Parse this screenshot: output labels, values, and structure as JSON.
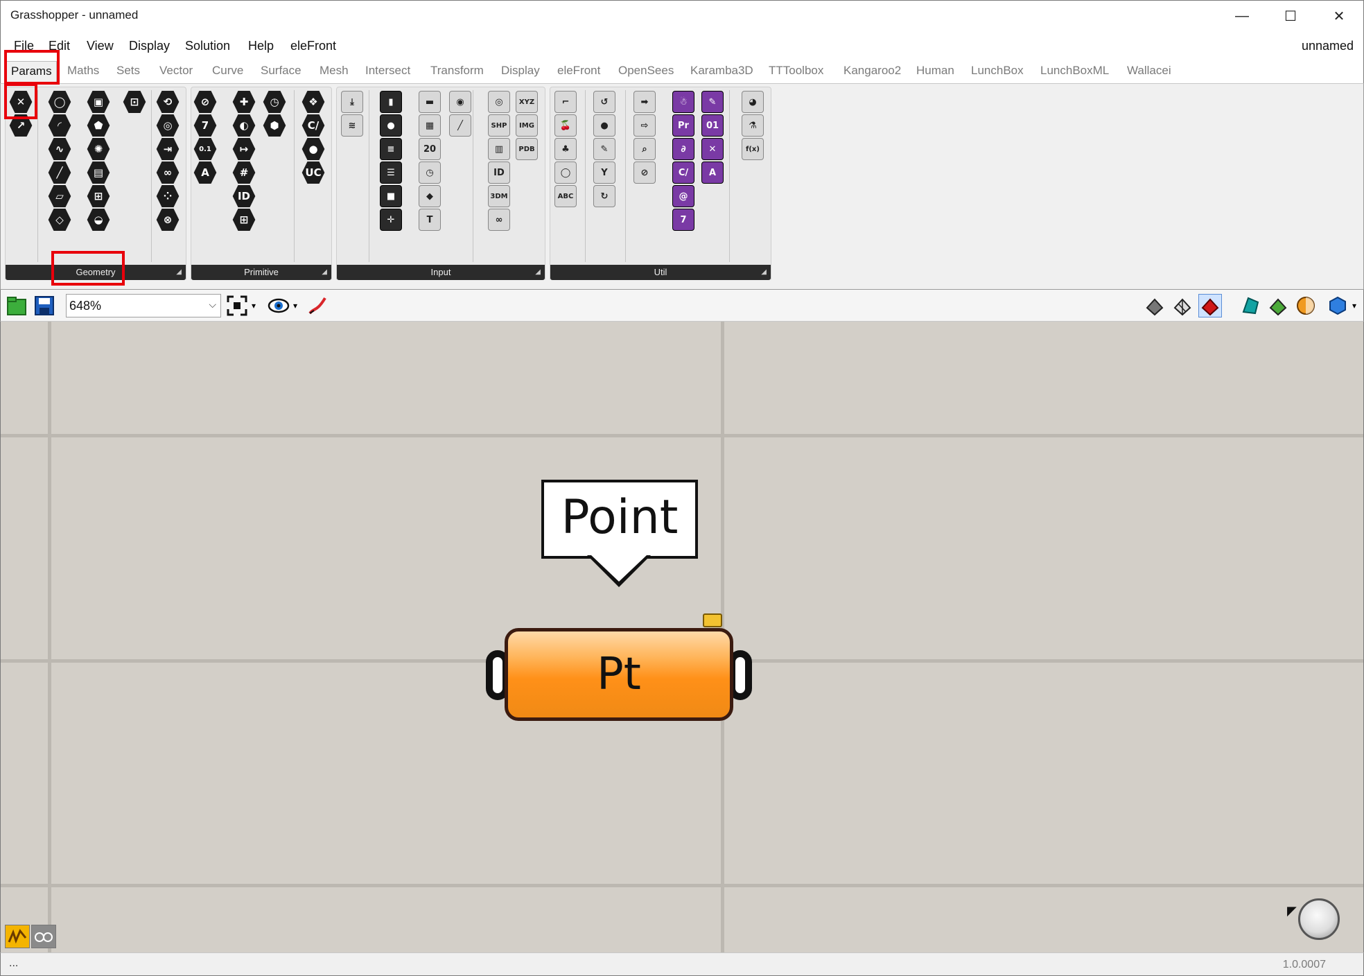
{
  "window": {
    "title": "Grasshopper - unnamed",
    "minimize": "—",
    "maximize": "☐",
    "close": "✕"
  },
  "menu": {
    "items": [
      "File",
      "Edit",
      "View",
      "Display",
      "Solution",
      "Help",
      "eleFront"
    ],
    "document_name": "unnamed"
  },
  "tabs": [
    "Params",
    "Maths",
    "Sets",
    "Vector",
    "Curve",
    "Surface",
    "Mesh",
    "Intersect",
    "Transform",
    "Display",
    "eleFront",
    "OpenSees",
    "Karamba3D",
    "TTToolbox",
    "Kangaroo2",
    "Human",
    "LunchBox",
    "LunchBoxML",
    "Wallacei"
  ],
  "active_tab": "Params",
  "panels": {
    "geometry": "Geometry",
    "primitive": "Primitive",
    "input": "Input",
    "util": "Util"
  },
  "ribbon_icons": {
    "geometry": [
      {
        "name": "point-param-icon",
        "glyph": "✕"
      },
      {
        "name": "vector-param-icon",
        "glyph": "↗"
      },
      {
        "name": "circle-param-icon",
        "glyph": "◯"
      },
      {
        "name": "arc-param-icon",
        "glyph": "◜"
      },
      {
        "name": "curve-param-icon",
        "glyph": "∿"
      },
      {
        "name": "line-param-icon",
        "glyph": "╱"
      },
      {
        "name": "rectangle-param-icon",
        "glyph": "▱"
      },
      {
        "name": "plane-param-icon",
        "glyph": "◇"
      },
      {
        "name": "box-param-icon",
        "glyph": "▣"
      },
      {
        "name": "brep-param-icon",
        "glyph": "⬟"
      },
      {
        "name": "mesh-param-icon",
        "glyph": "✺"
      },
      {
        "name": "surface-param-icon",
        "glyph": "▤"
      },
      {
        "name": "field-param-icon",
        "glyph": "⊞"
      },
      {
        "name": "atom-param-icon",
        "glyph": "◒"
      },
      {
        "name": "group-param-icon",
        "glyph": "⊡"
      },
      {
        "name": "twisted-box-param-icon",
        "glyph": "⟲"
      },
      {
        "name": "spiral-param-icon",
        "glyph": "◎"
      },
      {
        "name": "transform-param-icon",
        "glyph": "⇥"
      },
      {
        "name": "loop-param-icon",
        "glyph": "∞"
      },
      {
        "name": "cluster-param-icon",
        "glyph": "⁘"
      },
      {
        "name": "geometry-param-icon",
        "glyph": "⊗"
      }
    ],
    "primitive": [
      {
        "name": "boolean-param-icon",
        "glyph": "⊘"
      },
      {
        "name": "integer-param-icon",
        "glyph": "7"
      },
      {
        "name": "number-param-icon",
        "glyph": "0.1"
      },
      {
        "name": "text-param-icon",
        "glyph": "A"
      },
      {
        "name": "domain-param-icon",
        "glyph": "✚"
      },
      {
        "name": "shader-param-icon",
        "glyph": "◐"
      },
      {
        "name": "interval-param-icon",
        "glyph": "↦"
      },
      {
        "name": "domain2-param-icon",
        "glyph": "#"
      },
      {
        "name": "guid-param-icon",
        "glyph": "ID"
      },
      {
        "name": "matrix-param-icon",
        "glyph": "⊞"
      },
      {
        "name": "time-param-icon",
        "glyph": "◷"
      },
      {
        "name": "complex-param-icon",
        "glyph": "⬢"
      },
      {
        "name": "structure-param-icon",
        "glyph": "❖"
      },
      {
        "name": "culture-param-icon",
        "glyph": "C/"
      },
      {
        "name": "material-param-icon",
        "glyph": "●"
      },
      {
        "name": "file-path-param-icon",
        "glyph": "UC"
      }
    ],
    "input": [
      {
        "name": "data-input-icon",
        "glyph": "⤓"
      },
      {
        "name": "graph-mapper-icon",
        "glyph": "≋"
      },
      {
        "name": "toggle-icon",
        "glyph": "▮"
      },
      {
        "name": "button-icon",
        "glyph": "●"
      },
      {
        "name": "slider-icon",
        "glyph": "≡"
      },
      {
        "name": "value-list-icon",
        "glyph": "☰"
      },
      {
        "name": "digit-scroller-icon",
        "glyph": "■"
      },
      {
        "name": "control-knob-icon",
        "glyph": "✛"
      },
      {
        "name": "gradient-icon",
        "glyph": "▬"
      },
      {
        "name": "checker-icon",
        "glyph": "▦"
      },
      {
        "name": "calendar-icon",
        "glyph": "20"
      },
      {
        "name": "clock-icon",
        "glyph": "◷"
      },
      {
        "name": "colour-swatch-icon",
        "glyph": "◆"
      },
      {
        "name": "colour-picker-icon",
        "glyph": "T"
      },
      {
        "name": "colour-wheel-icon",
        "glyph": "◉"
      },
      {
        "name": "md-slider-icon",
        "glyph": "╱"
      },
      {
        "name": "target-icon",
        "glyph": "◎"
      },
      {
        "name": "shp-import-icon",
        "glyph": "SHP"
      },
      {
        "name": "spectrum-icon",
        "glyph": "▥"
      },
      {
        "name": "id-tag-icon",
        "glyph": "ID"
      },
      {
        "name": "3dm-import-icon",
        "glyph": "3DM"
      },
      {
        "name": "tape-icon",
        "glyph": "∞"
      },
      {
        "name": "xyz-import-icon",
        "glyph": "XYZ"
      },
      {
        "name": "img-import-icon",
        "glyph": "IMG"
      },
      {
        "name": "pdb-import-icon",
        "glyph": "PDB"
      }
    ],
    "util": [
      {
        "name": "glasses-icon",
        "glyph": "⌐"
      },
      {
        "name": "cherry-icon",
        "glyph": "🍒"
      },
      {
        "name": "tree-icon",
        "glyph": "♣"
      },
      {
        "name": "circle-util-icon",
        "glyph": "◯"
      },
      {
        "name": "abc-icon",
        "glyph": "ABC"
      },
      {
        "name": "jump-icon",
        "glyph": "↺"
      },
      {
        "name": "record-icon",
        "glyph": "●"
      },
      {
        "name": "pencil-icon",
        "glyph": "✎"
      },
      {
        "name": "hook-icon",
        "glyph": "Y"
      },
      {
        "name": "magnet-icon",
        "glyph": "↻"
      },
      {
        "name": "arrow-right-icon",
        "glyph": "➡"
      },
      {
        "name": "arrow-outline-icon",
        "glyph": "⇨"
      },
      {
        "name": "search-icon",
        "glyph": "⌕"
      },
      {
        "name": "clock-search-icon",
        "glyph": "⊘"
      },
      {
        "name": "snowman-icon",
        "glyph": "☃"
      },
      {
        "name": "premiere-icon",
        "glyph": "Pr"
      },
      {
        "name": "python-icon",
        "glyph": "∂"
      },
      {
        "name": "csharp-icon",
        "glyph": "C/"
      },
      {
        "name": "spiral-util-icon",
        "glyph": "@"
      },
      {
        "name": "seven-icon",
        "glyph": "7"
      },
      {
        "name": "script-icon",
        "glyph": "✎"
      },
      {
        "name": "binary-icon",
        "glyph": "01"
      },
      {
        "name": "cancel-script-icon",
        "glyph": "✕"
      },
      {
        "name": "text-script-icon",
        "glyph": "A"
      },
      {
        "name": "eyeball-icon",
        "glyph": "◕"
      },
      {
        "name": "flask-icon",
        "glyph": "⚗"
      },
      {
        "name": "fx-icon",
        "glyph": "f(x)"
      }
    ]
  },
  "toolbar": {
    "zoom": "648%"
  },
  "canvas": {
    "tooltip": "Point",
    "component_label": "Pt"
  },
  "status": {
    "left": "...",
    "version": "1.0.0007"
  },
  "colors": {
    "highlight": "#e8000b",
    "component_fill": "#ff9018",
    "canvas_bg": "#d3cfc8"
  }
}
